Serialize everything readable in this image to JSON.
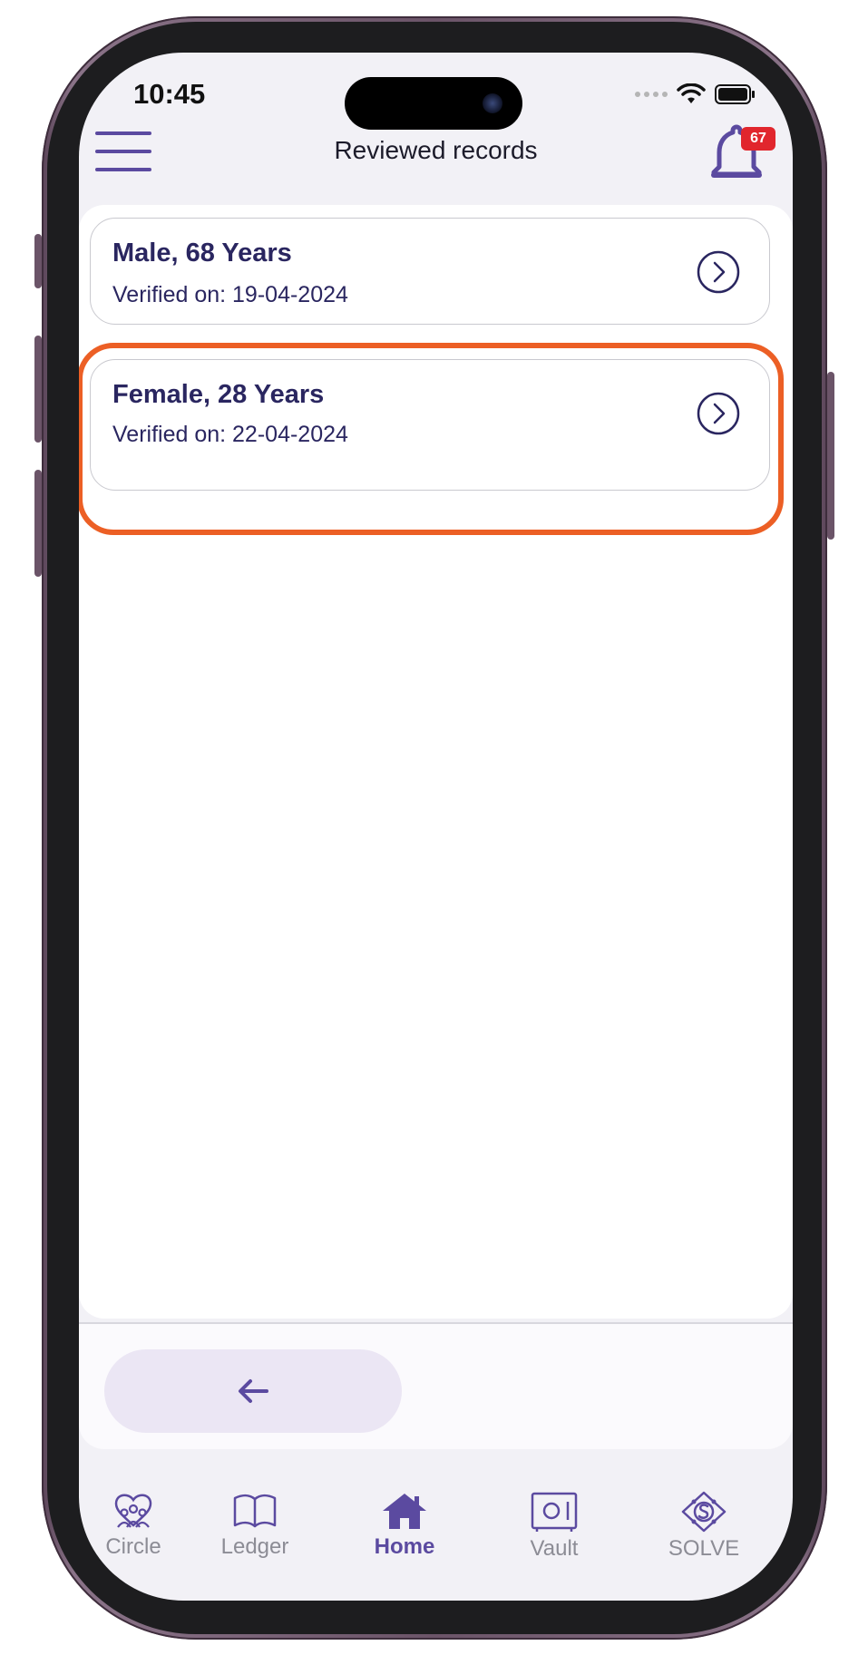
{
  "status_bar": {
    "time": "10:45"
  },
  "header": {
    "title": "Reviewed records",
    "notification_count": "67"
  },
  "records": [
    {
      "title": "Male, 68 Years",
      "verified": "Verified on: 19-04-2024"
    },
    {
      "title": "Female, 28 Years",
      "verified": "Verified on: 22-04-2024"
    }
  ],
  "footer": {
    "back_icon": "arrow-left-icon"
  },
  "tabs": [
    {
      "label": "Circle",
      "icon": "circle-icon"
    },
    {
      "label": "Ledger",
      "icon": "book-icon"
    },
    {
      "label": "Home",
      "icon": "home-icon",
      "active": true
    },
    {
      "label": "Vault",
      "icon": "vault-icon"
    },
    {
      "label": "SOLVE",
      "icon": "solve-icon"
    }
  ],
  "colors": {
    "accent": "#5b4aa0",
    "text_dark": "#2a2660",
    "highlight": "#ec5f25",
    "badge": "#e1262d"
  }
}
